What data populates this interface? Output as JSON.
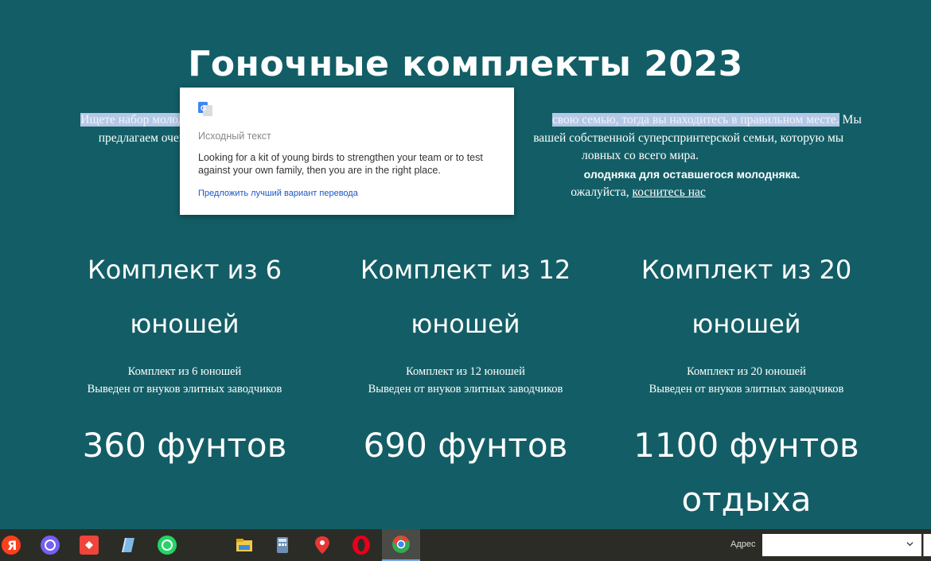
{
  "page": {
    "title": "Гоночные комплекты 2023",
    "intro": {
      "selected_start": "Ищете набор молоды",
      "selected_end": "свою семью, тогда вы находитесь в правильном месте.",
      "after_selected": " Мы",
      "line2_left": "предлагаем очень",
      "line2_right": "вашей собственной суперспринтерской семьи, которую мы",
      "line3_right": "ловных со всего мира.",
      "line4_bold": "олодняка для оставшегося молодняка.",
      "line5_text": "ожалуйста, ",
      "contact_link": "коснитесь нас"
    },
    "kits": [
      {
        "heading": "Комплект из 6 юношей",
        "desc1": "Комплект из 6 юношей",
        "desc2": "Выведен от внуков элитных заводчиков",
        "price": "360 фунтов"
      },
      {
        "heading": "Комплект из 12 юношей",
        "desc1": "Комплект из 12 юношей",
        "desc2": "Выведен от внуков элитных заводчиков",
        "price": "690 фунтов"
      },
      {
        "heading": "Комплект из 20 юношей",
        "desc1": "Комплект из 20 юношей",
        "desc2": "Выведен от внуков элитных заводчиков",
        "price": "1100 фунтов отдыха"
      }
    ]
  },
  "translate_popup": {
    "icon": "google-translate-icon",
    "source_label": "Исходный текст",
    "source_text": "Looking for a kit of young birds to strengthen your team or to test against your own family, then you are in the right place.",
    "suggest_link": "Предложить лучший вариант перевода"
  },
  "taskbar": {
    "apps": [
      "yandex-icon",
      "viber-icon",
      "anydesk-icon",
      "notepad-icon",
      "whatsapp-icon",
      "file-explorer-icon",
      "calculator-icon",
      "maps-icon",
      "opera-icon",
      "chrome-icon"
    ],
    "address_label": "Адрес",
    "address_value": ""
  },
  "colors": {
    "background": "#135e66",
    "selection": "#b4c8e6",
    "taskbar": "#2c2c26",
    "link": "#1a56c7"
  }
}
